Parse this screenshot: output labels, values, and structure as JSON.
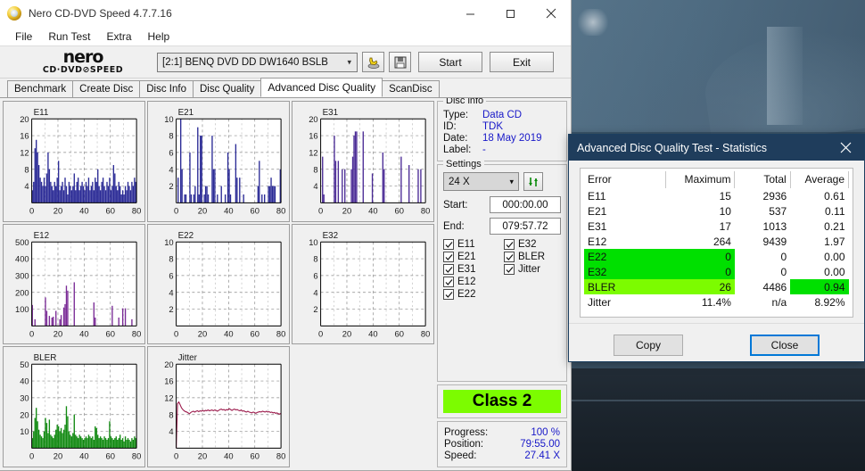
{
  "window": {
    "title": "Nero CD-DVD Speed 4.7.7.16",
    "icon": "nero-app-icon",
    "minimize": "minimize-icon",
    "maximize": "maximize-icon",
    "close": "close-icon"
  },
  "menu": [
    {
      "label": "File"
    },
    {
      "label": "Run Test"
    },
    {
      "label": "Extra"
    },
    {
      "label": "Help"
    }
  ],
  "toolbar": {
    "logo_word": "nero",
    "logo_sub": "CD·DVD⊘SPEED",
    "drive": "[2:1]   BENQ DVD DD DW1640 BSLB",
    "drive_chevron": "chevron-down-icon",
    "eject_icon": "hand-disc-icon",
    "save_icon": "floppy-save-icon",
    "start_label": "Start",
    "exit_label": "Exit"
  },
  "tabs": [
    {
      "label": "Benchmark",
      "active": false
    },
    {
      "label": "Create Disc",
      "active": false
    },
    {
      "label": "Disc Info",
      "active": false
    },
    {
      "label": "Disc Quality",
      "active": false
    },
    {
      "label": "Advanced Disc Quality",
      "active": true
    },
    {
      "label": "ScanDisc",
      "active": false
    }
  ],
  "disc_info": {
    "legend": "Disc info",
    "rows": [
      {
        "key": "Type:",
        "value": "Data CD"
      },
      {
        "key": "ID:",
        "value": "TDK"
      },
      {
        "key": "Date:",
        "value": "18 May 2019"
      },
      {
        "key": "Label:",
        "value": "-"
      }
    ]
  },
  "settings": {
    "legend": "Settings",
    "speed": "24 X",
    "speed_chevron": "chevron-down-icon",
    "refresh_icon": "refresh-arrows-icon",
    "start_label": "Start:",
    "start_value": "000:00.00",
    "end_label": "End:",
    "end_value": "079:57.72",
    "checks": [
      {
        "label": "E11",
        "checked": true
      },
      {
        "label": "E32",
        "checked": true
      },
      {
        "label": "E21",
        "checked": true
      },
      {
        "label": "BLER",
        "checked": true
      },
      {
        "label": "E31",
        "checked": true
      },
      {
        "label": "Jitter",
        "checked": true
      },
      {
        "label": "E12",
        "checked": true
      },
      {
        "label": "",
        "checked": null
      },
      {
        "label": "E22",
        "checked": true
      },
      {
        "label": "",
        "checked": null
      }
    ]
  },
  "class_box": {
    "label": "Class 2",
    "color": "#7cfc00"
  },
  "progress": {
    "rows": [
      {
        "key": "Progress:",
        "value": "100 %"
      },
      {
        "key": "Position:",
        "value": "79:55.00"
      },
      {
        "key": "Speed:",
        "value": "27.41 X"
      }
    ]
  },
  "stats_dialog": {
    "title": "Advanced Disc Quality Test - Statistics",
    "close_icon": "close-icon",
    "columns": [
      "Error",
      "Maximum",
      "Total",
      "Average"
    ],
    "rows": [
      {
        "error": "E11",
        "maximum": "15",
        "total": "2936",
        "average": "0.61",
        "hl": "none"
      },
      {
        "error": "E21",
        "maximum": "10",
        "total": "537",
        "average": "0.11",
        "hl": "none"
      },
      {
        "error": "E31",
        "maximum": "17",
        "total": "1013",
        "average": "0.21",
        "hl": "none"
      },
      {
        "error": "E12",
        "maximum": "264",
        "total": "9439",
        "average": "1.97",
        "hl": "none"
      },
      {
        "error": "E22",
        "maximum": "0",
        "total": "0",
        "average": "0.00",
        "hl": "left"
      },
      {
        "error": "E32",
        "maximum": "0",
        "total": "0",
        "average": "0.00",
        "hl": "left"
      },
      {
        "error": "BLER",
        "maximum": "26",
        "total": "4486",
        "average": "0.94",
        "hl": "left-light-avg"
      },
      {
        "error": "Jitter",
        "maximum": "11.4%",
        "total": "n/a",
        "average": "8.92%",
        "hl": "none"
      }
    ],
    "copy_label": "Copy",
    "close_label": "Close",
    "highlight_green": "#00e000",
    "highlight_light_green": "#7cfc00"
  },
  "chart_data": [
    {
      "type": "bar",
      "title": "E11",
      "xlabel": "",
      "ylabel": "",
      "ylim": [
        0,
        20
      ],
      "xlim": [
        0,
        80
      ],
      "yticks": [
        4,
        8,
        12,
        16,
        20
      ],
      "xticks": [
        0,
        20,
        40,
        60,
        80
      ],
      "color": "#2b2b96",
      "grid": true,
      "values": [
        3,
        5,
        13,
        15,
        12,
        9,
        6,
        5,
        4,
        6,
        4,
        7,
        12,
        8,
        5,
        4,
        3,
        5,
        4,
        6,
        10,
        3,
        4,
        5,
        3,
        6,
        4,
        2,
        5,
        4,
        3,
        4,
        7,
        3,
        5,
        6,
        3,
        4,
        5,
        4,
        3,
        5,
        4,
        6,
        3,
        4,
        5,
        3,
        6,
        5,
        8,
        4,
        3,
        5,
        6,
        4,
        3,
        5,
        4,
        6,
        3,
        4,
        9,
        7,
        4,
        3,
        5,
        4,
        2,
        3,
        2,
        4,
        3,
        5,
        4,
        3,
        5,
        4,
        6,
        5
      ]
    },
    {
      "type": "bar",
      "title": "E21",
      "xlabel": "",
      "ylabel": "",
      "ylim": [
        0,
        10
      ],
      "xlim": [
        0,
        80
      ],
      "yticks": [
        2,
        4,
        6,
        8,
        10
      ],
      "xticks": [
        0,
        20,
        40,
        60,
        80
      ],
      "color": "#2b2b96",
      "grid": true,
      "values": [
        0,
        3,
        0,
        10,
        4,
        0,
        1,
        1,
        0,
        0,
        6,
        1,
        0,
        1,
        2,
        0,
        9,
        1,
        8,
        8,
        0,
        1,
        2,
        2,
        1,
        0,
        0,
        8,
        4,
        4,
        0,
        1,
        0,
        0,
        2,
        0,
        0,
        1,
        0,
        6,
        4,
        1,
        0,
        0,
        0,
        7,
        3,
        0,
        3,
        0,
        0,
        1,
        0,
        0,
        0,
        0,
        0,
        0,
        0,
        0,
        0,
        0,
        2,
        5,
        0,
        1,
        0,
        1,
        0,
        0,
        2,
        2,
        3,
        2,
        2,
        2,
        0,
        0,
        0,
        4
      ]
    },
    {
      "type": "bar",
      "title": "E31",
      "xlabel": "",
      "ylabel": "",
      "ylim": [
        0,
        20
      ],
      "xlim": [
        0,
        80
      ],
      "yticks": [
        4,
        8,
        12,
        16,
        20
      ],
      "xticks": [
        0,
        20,
        40,
        60,
        80
      ],
      "color": "#4b2b96",
      "grid": true,
      "values": [
        0,
        11,
        2,
        0,
        0,
        0,
        0,
        0,
        0,
        0,
        16,
        10,
        0,
        10,
        0,
        0,
        8,
        0,
        8,
        0,
        0,
        0,
        0,
        8,
        11,
        16,
        17,
        17,
        0,
        0,
        0,
        0,
        17,
        0,
        0,
        0,
        0,
        0,
        0,
        7,
        0,
        0,
        0,
        0,
        0,
        0,
        0,
        12,
        8,
        0,
        0,
        0,
        0,
        0,
        0,
        0,
        0,
        0,
        0,
        0,
        0,
        11,
        0,
        0,
        0,
        0,
        0,
        9,
        0,
        0,
        0,
        0,
        0,
        0,
        8,
        0,
        8,
        0,
        0,
        0
      ]
    },
    {
      "type": "bar",
      "title": "E12",
      "xlabel": "",
      "ylabel": "",
      "ylim": [
        0,
        500
      ],
      "xlim": [
        0,
        80
      ],
      "yticks": [
        100,
        200,
        300,
        400,
        500
      ],
      "xticks": [
        0,
        20,
        40,
        60,
        80
      ],
      "color": "#7a2b96",
      "grid": true,
      "values": [
        125,
        0,
        40,
        0,
        0,
        0,
        0,
        0,
        0,
        0,
        170,
        90,
        0,
        60,
        0,
        50,
        55,
        0,
        90,
        0,
        0,
        40,
        65,
        0,
        110,
        130,
        240,
        210,
        0,
        0,
        0,
        0,
        260,
        0,
        0,
        0,
        0,
        0,
        0,
        0,
        0,
        0,
        0,
        0,
        0,
        0,
        0,
        140,
        50,
        0,
        0,
        0,
        0,
        0,
        0,
        0,
        0,
        0,
        0,
        0,
        0,
        120,
        0,
        0,
        0,
        0,
        50,
        0,
        0,
        105,
        0,
        105,
        0,
        0,
        0,
        0,
        40,
        0,
        0,
        0
      ]
    },
    {
      "type": "bar",
      "title": "E22",
      "xlabel": "",
      "ylabel": "",
      "ylim": [
        0,
        10
      ],
      "xlim": [
        0,
        80
      ],
      "yticks": [
        2,
        4,
        6,
        8,
        10
      ],
      "xticks": [
        0,
        20,
        40,
        60,
        80
      ],
      "color": "#2b2b96",
      "grid": true,
      "values": []
    },
    {
      "type": "bar",
      "title": "E32",
      "xlabel": "",
      "ylabel": "",
      "ylim": [
        0,
        10
      ],
      "xlim": [
        0,
        80
      ],
      "yticks": [
        2,
        4,
        6,
        8,
        10
      ],
      "xticks": [
        0,
        20,
        40,
        60,
        80
      ],
      "color": "#2b2b96",
      "grid": true,
      "values": []
    },
    {
      "type": "bar",
      "title": "BLER",
      "xlabel": "",
      "ylabel": "",
      "ylim": [
        0,
        50
      ],
      "xlim": [
        0,
        80
      ],
      "yticks": [
        10,
        20,
        30,
        40,
        50
      ],
      "xticks": [
        0,
        20,
        40,
        60,
        80
      ],
      "color": "#128a12",
      "grid": true,
      "values": [
        6,
        10,
        18,
        24,
        16,
        11,
        8,
        7,
        6,
        10,
        18,
        15,
        9,
        17,
        8,
        7,
        6,
        8,
        11,
        14,
        13,
        10,
        12,
        9,
        11,
        14,
        25,
        19,
        10,
        8,
        7,
        9,
        20,
        8,
        7,
        6,
        8,
        7,
        6,
        5,
        6,
        7,
        6,
        8,
        7,
        6,
        7,
        5,
        13,
        12,
        8,
        6,
        7,
        6,
        5,
        7,
        6,
        5,
        6,
        16,
        7,
        6,
        5,
        6,
        7,
        5,
        6,
        8,
        5,
        6,
        4,
        7,
        5,
        6,
        5,
        4,
        6,
        5,
        7,
        6
      ]
    },
    {
      "type": "line",
      "title": "Jitter",
      "xlabel": "",
      "ylabel": "",
      "ylim": [
        0,
        20
      ],
      "xlim": [
        0,
        80
      ],
      "yticks": [
        4,
        8,
        12,
        16,
        20
      ],
      "xticks": [
        0,
        20,
        40,
        60,
        80
      ],
      "color": "#9c1b4c",
      "grid": true,
      "values": [
        0,
        10.6,
        11.0,
        10.3,
        9.6,
        9.2,
        8.9,
        8.7,
        8.6,
        8.4,
        8.2,
        8.5,
        8.7,
        8.8,
        8.6,
        8.8,
        8.9,
        8.7,
        8.9,
        8.8,
        9.0,
        8.8,
        9.0,
        8.9,
        9.1,
        8.9,
        9.0,
        9.1,
        8.9,
        9.1,
        9.0,
        8.8,
        9.0,
        9.2,
        9.3,
        9.1,
        9.2,
        9.0,
        9.2,
        9.1,
        9.4,
        9.2,
        9.0,
        9.2,
        9.3,
        9.1,
        9.2,
        9.0,
        8.9,
        9.1,
        8.8,
        8.9,
        8.7,
        8.6,
        8.8,
        8.6,
        8.5,
        8.4,
        8.6,
        8.5,
        8.3,
        8.5,
        8.6,
        8.7,
        8.6,
        8.8,
        8.7,
        8.6,
        8.8,
        8.6,
        8.7,
        8.5,
        8.6,
        8.4,
        8.5,
        8.3,
        8.4,
        8.2,
        8.1,
        8.3
      ]
    }
  ]
}
